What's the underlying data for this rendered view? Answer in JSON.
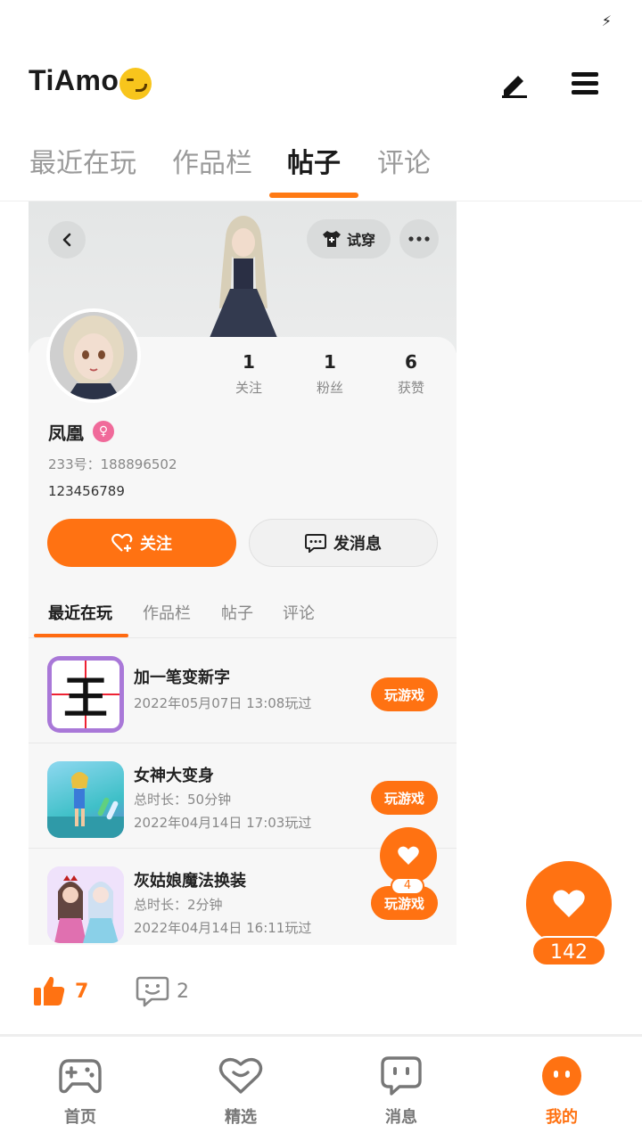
{
  "app": {
    "title": "TiAmo."
  },
  "top_tabs": [
    {
      "label": "最近在玩"
    },
    {
      "label": "作品栏"
    },
    {
      "label": "帖子"
    },
    {
      "label": "评论"
    }
  ],
  "card": {
    "try_on_label": "试穿",
    "stats": [
      {
        "value": "1",
        "label": "关注"
      },
      {
        "value": "1",
        "label": "粉丝"
      },
      {
        "value": "6",
        "label": "获赞"
      }
    ],
    "username": "凤凰",
    "uid": "233号：188896502",
    "bio": "123456789",
    "follow_label": "关注",
    "message_label": "发消息",
    "sub_tabs": [
      {
        "label": "最近在玩"
      },
      {
        "label": "作品栏"
      },
      {
        "label": "帖子"
      },
      {
        "label": "评论"
      }
    ],
    "games": [
      {
        "name": "加一笔变新字",
        "duration": "",
        "played": "2022年05月07日 13:08玩过",
        "button": "玩游戏",
        "icon_char": "王"
      },
      {
        "name": "女神大变身",
        "duration": "总时长：50分钟",
        "played": "2022年04月14日 17:03玩过",
        "button": "玩游戏"
      },
      {
        "name": "灰姑娘魔法换装",
        "duration": "总时长：2分钟",
        "played": "2022年04月14日 16:11玩过",
        "button": "玩游戏"
      }
    ],
    "mini_like_count": "4"
  },
  "like_float_count": "142",
  "post_actions": {
    "likes": "7",
    "comments": "2"
  },
  "bottom_nav": [
    {
      "label": "首页"
    },
    {
      "label": "精选"
    },
    {
      "label": "消息"
    },
    {
      "label": "我的"
    }
  ],
  "colors": {
    "accent": "#ff7212",
    "text": "#222222",
    "muted": "#888888"
  }
}
